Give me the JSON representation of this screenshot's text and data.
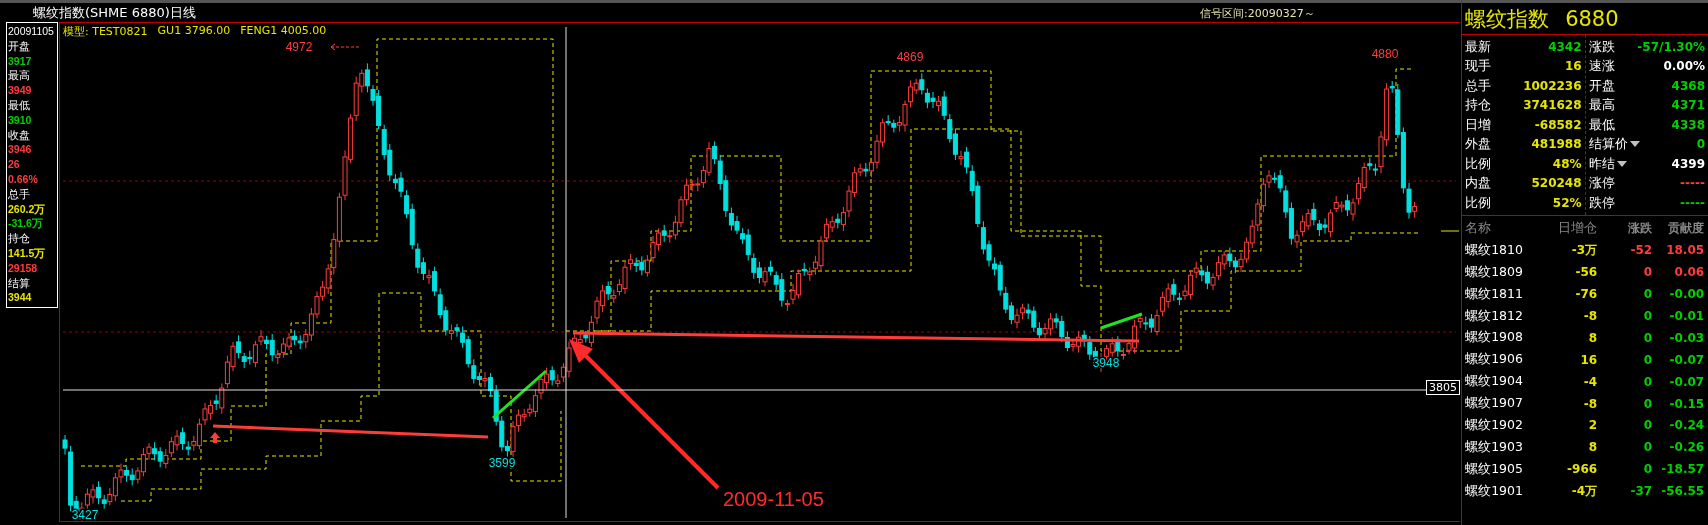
{
  "window": {
    "title": "螺纹指数(SHME 6880)日线",
    "signal_range": "信号区间:20090327～"
  },
  "info_panel": {
    "items": [
      {
        "kind": "label",
        "text": "20091105"
      },
      {
        "kind": "label",
        "text": "开盘"
      },
      {
        "kind": "value",
        "text": "3917",
        "color": "#00d000"
      },
      {
        "kind": "label",
        "text": "最高"
      },
      {
        "kind": "value",
        "text": "3949",
        "color": "#ff3c3c"
      },
      {
        "kind": "label",
        "text": "最低"
      },
      {
        "kind": "value",
        "text": "3910",
        "color": "#00d000"
      },
      {
        "kind": "label",
        "text": "收盘"
      },
      {
        "kind": "value",
        "text": "3946",
        "color": "#ff3c3c"
      },
      {
        "kind": "value",
        "text": "26",
        "color": "#ff3c3c"
      },
      {
        "kind": "value",
        "text": "0.66%",
        "color": "#ff3c3c"
      },
      {
        "kind": "label",
        "text": "总手"
      },
      {
        "kind": "value",
        "text": "260.2万",
        "color": "#e6e600"
      },
      {
        "kind": "value",
        "text": "-31.6万",
        "color": "#00d000"
      },
      {
        "kind": "label",
        "text": "持仓"
      },
      {
        "kind": "value",
        "text": "141.5万",
        "color": "#e6e600"
      },
      {
        "kind": "value",
        "text": "29158",
        "color": "#ff3c3c"
      },
      {
        "kind": "label",
        "text": "结算"
      },
      {
        "kind": "value",
        "text": "3944",
        "color": "#e6e600"
      }
    ]
  },
  "chart": {
    "header": [
      "模型: TEST0821",
      "GU1 3796.00",
      "FENG1 4005.00"
    ],
    "price_labels": [
      {
        "text": "4972",
        "kind": "high"
      },
      {
        "text": "4869",
        "kind": "high"
      },
      {
        "text": "4880",
        "kind": "high"
      },
      {
        "text": "3599",
        "kind": "low"
      },
      {
        "text": "3948",
        "kind": "low"
      },
      {
        "text": "3427",
        "kind": "low"
      }
    ],
    "crosshair_price": "3805",
    "date_annotation": "2009-11-05"
  },
  "quote": {
    "name": "螺纹指数",
    "code": "6880",
    "left": [
      {
        "label": "最新",
        "value": "4342",
        "color": "#00d000"
      },
      {
        "label": "现手",
        "value": "16",
        "color": "#e6e600"
      },
      {
        "label": "总手",
        "value": "1002236",
        "color": "#e6e600"
      },
      {
        "label": "持仓",
        "value": "3741628",
        "color": "#e6e600"
      },
      {
        "label": "日增",
        "value": "-68582",
        "color": "#e6e600"
      },
      {
        "label": "外盘",
        "value": "481988",
        "color": "#e6e600"
      },
      {
        "label": "比例",
        "value": "48%",
        "color": "#e6e600"
      },
      {
        "label": "内盘",
        "value": "520248",
        "color": "#e6e600"
      },
      {
        "label": "比例",
        "value": "52%",
        "color": "#e6e600"
      }
    ],
    "right": [
      {
        "label": "涨跌",
        "value": "-57/1.30%",
        "color": "#00d000",
        "dropdown": false
      },
      {
        "label": "速涨",
        "value": "0.00%",
        "color": "#ffffff",
        "dropdown": false
      },
      {
        "label": "开盘",
        "value": "4368",
        "color": "#00d000",
        "dropdown": false
      },
      {
        "label": "最高",
        "value": "4371",
        "color": "#00d000",
        "dropdown": false
      },
      {
        "label": "最低",
        "value": "4338",
        "color": "#00d000",
        "dropdown": false
      },
      {
        "label": "结算价",
        "value": "0",
        "color": "#00d000",
        "dropdown": true
      },
      {
        "label": "昨结",
        "value": "4399",
        "color": "#ffffff",
        "dropdown": true
      },
      {
        "label": "涨停",
        "value": "-----",
        "color": "#ff3c3c",
        "dropdown": false
      },
      {
        "label": "跌停",
        "value": "-----",
        "color": "#00d000",
        "dropdown": false
      }
    ]
  },
  "table": {
    "columns": [
      "名称",
      "日增仓",
      "涨跌",
      "贡献度"
    ],
    "rows": [
      {
        "name": "螺纹1810",
        "oi_change": "-3万",
        "change": "-52",
        "contribution": "18.05",
        "color": "#ff3c3c"
      },
      {
        "name": "螺纹1809",
        "oi_change": "-56",
        "change": "0",
        "contribution": "0.06",
        "color": "#ff3c3c"
      },
      {
        "name": "螺纹1811",
        "oi_change": "-76",
        "change": "0",
        "contribution": "-0.00",
        "color": "#00d000"
      },
      {
        "name": "螺纹1812",
        "oi_change": "-8",
        "change": "0",
        "contribution": "-0.01",
        "color": "#00d000"
      },
      {
        "name": "螺纹1908",
        "oi_change": "8",
        "change": "0",
        "contribution": "-0.03",
        "color": "#00d000"
      },
      {
        "name": "螺纹1906",
        "oi_change": "16",
        "change": "0",
        "contribution": "-0.07",
        "color": "#00d000"
      },
      {
        "name": "螺纹1904",
        "oi_change": "-4",
        "change": "0",
        "contribution": "-0.07",
        "color": "#00d000"
      },
      {
        "name": "螺纹1907",
        "oi_change": "-8",
        "change": "0",
        "contribution": "-0.15",
        "color": "#00d000"
      },
      {
        "name": "螺纹1902",
        "oi_change": "2",
        "change": "0",
        "contribution": "-0.24",
        "color": "#00d000"
      },
      {
        "name": "螺纹1903",
        "oi_change": "8",
        "change": "0",
        "contribution": "-0.26",
        "color": "#00d000"
      },
      {
        "name": "螺纹1905",
        "oi_change": "-966",
        "change": "0",
        "contribution": "-18.57",
        "color": "#00d000"
      },
      {
        "name": "螺纹1901",
        "oi_change": "-4万",
        "change": "-37",
        "contribution": "-56.55",
        "color": "#00d000"
      }
    ]
  }
}
